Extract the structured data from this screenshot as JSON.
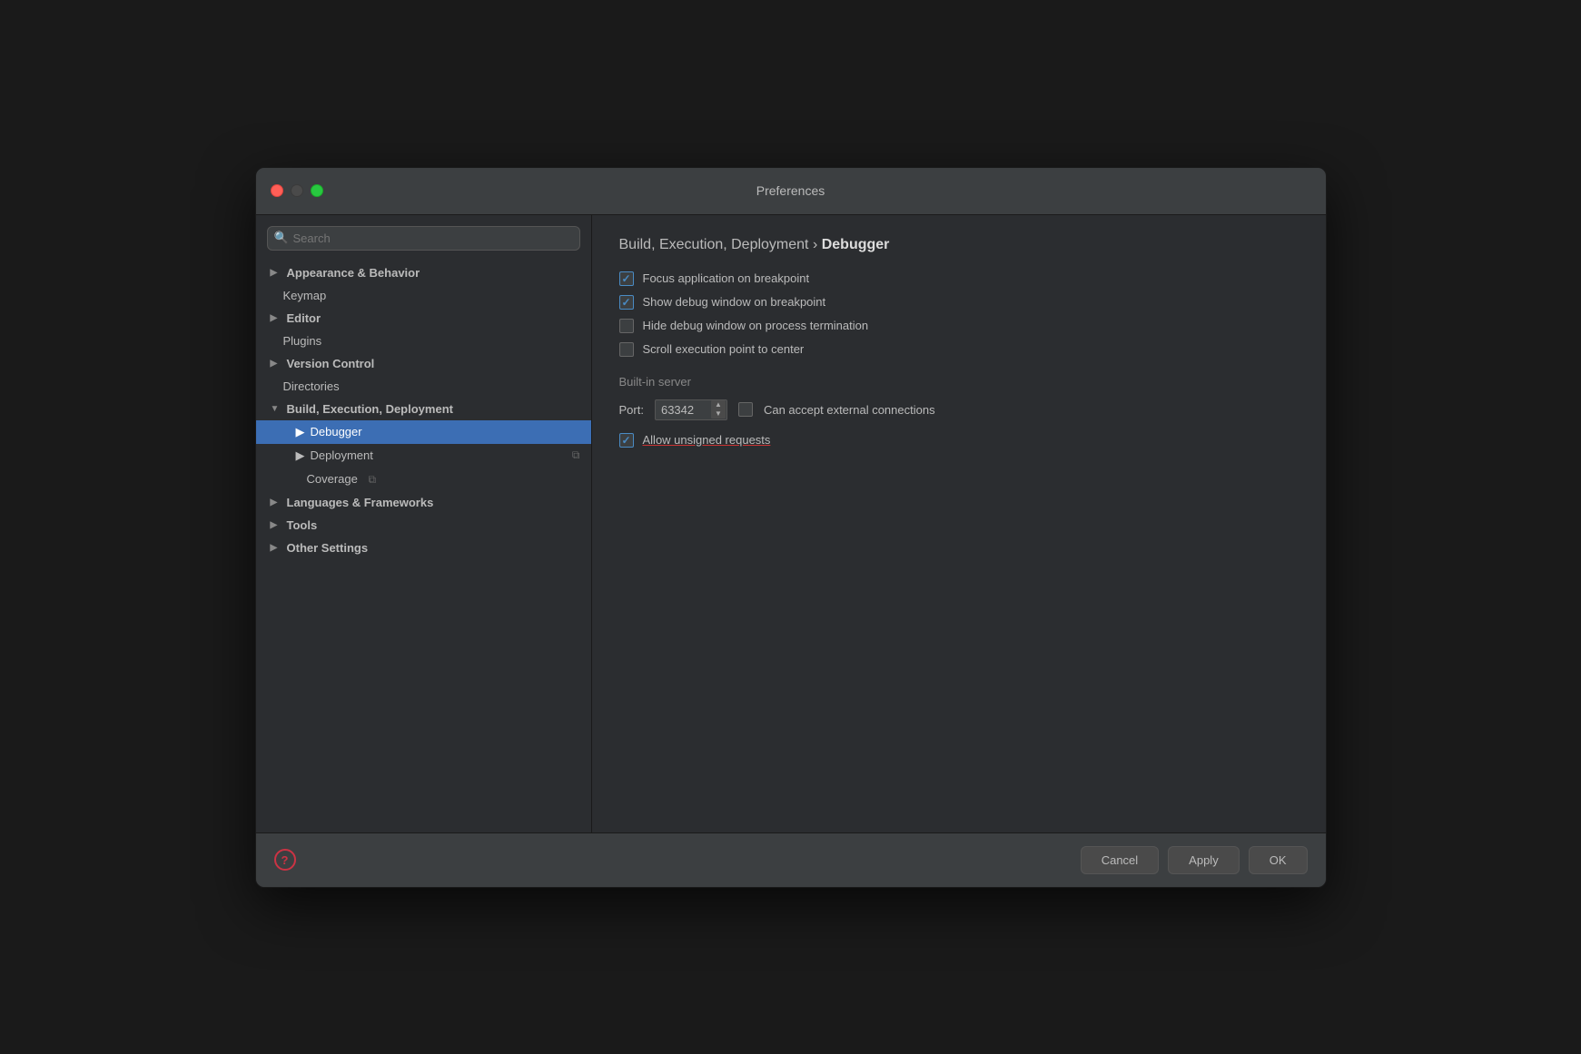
{
  "window": {
    "title": "Preferences"
  },
  "sidebar": {
    "search_placeholder": "Search",
    "items": [
      {
        "id": "appearance",
        "label": "Appearance & Behavior",
        "type": "expandable",
        "expanded": true
      },
      {
        "id": "keymap",
        "label": "Keymap",
        "type": "plain"
      },
      {
        "id": "editor",
        "label": "Editor",
        "type": "expandable"
      },
      {
        "id": "plugins",
        "label": "Plugins",
        "type": "plain"
      },
      {
        "id": "version-control",
        "label": "Version Control",
        "type": "expandable"
      },
      {
        "id": "directories",
        "label": "Directories",
        "type": "plain"
      },
      {
        "id": "build",
        "label": "Build, Execution, Deployment",
        "type": "expandable",
        "expanded": true
      },
      {
        "id": "debugger",
        "label": "Debugger",
        "type": "sub",
        "active": true
      },
      {
        "id": "deployment",
        "label": "Deployment",
        "type": "sub",
        "has_copy": true
      },
      {
        "id": "coverage",
        "label": "Coverage",
        "type": "sub-plain",
        "has_copy": true
      },
      {
        "id": "languages",
        "label": "Languages & Frameworks",
        "type": "expandable"
      },
      {
        "id": "tools",
        "label": "Tools",
        "type": "expandable"
      },
      {
        "id": "other",
        "label": "Other Settings",
        "type": "expandable"
      }
    ]
  },
  "main": {
    "breadcrumb_prefix": "Build, Execution, Deployment › ",
    "breadcrumb_suffix": "Debugger",
    "checkboxes": [
      {
        "id": "focus-app",
        "label": "Focus application on breakpoint",
        "checked": true
      },
      {
        "id": "show-debug",
        "label": "Show debug window on breakpoint",
        "checked": true
      },
      {
        "id": "hide-debug",
        "label": "Hide debug window on process termination",
        "checked": false
      },
      {
        "id": "scroll-exec",
        "label": "Scroll execution point to center",
        "checked": false
      }
    ],
    "server_section": "Built-in server",
    "port_label": "Port:",
    "port_value": "63342",
    "can_accept_label": "Can accept external connections",
    "can_accept_checked": false,
    "allow_unsigned_label": "Allow unsigned requests",
    "allow_unsigned_checked": true
  },
  "footer": {
    "cancel_label": "Cancel",
    "apply_label": "Apply",
    "ok_label": "OK"
  }
}
